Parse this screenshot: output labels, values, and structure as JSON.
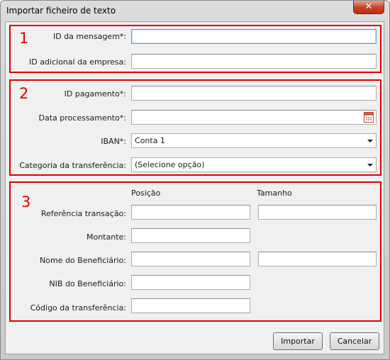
{
  "window": {
    "title": "Importar ficheiro de texto",
    "close_glyph": "✕"
  },
  "groups": [
    {
      "number": "1",
      "fields": [
        {
          "label": "ID da mensagem*:",
          "value": ""
        },
        {
          "label": "ID adicional da empresa:",
          "value": ""
        }
      ]
    },
    {
      "number": "2",
      "fields": [
        {
          "label": "ID pagamento*:",
          "value": ""
        },
        {
          "label": "Data processamento*:",
          "value": ""
        },
        {
          "label": "IBAN*:",
          "value": "Conta 1"
        },
        {
          "label": "Categoria da transferência:",
          "value": "(Selecione opção)"
        }
      ]
    },
    {
      "number": "3",
      "headers": {
        "position": "Posição",
        "size": "Tamanho"
      },
      "fields": [
        {
          "label": "Referência transação:",
          "position": "",
          "size": ""
        },
        {
          "label": "Montante:",
          "position": ""
        },
        {
          "label": "Nome do Beneficiário:",
          "position": "",
          "size": ""
        },
        {
          "label": "NIB do Beneficiário:",
          "position": ""
        },
        {
          "label": "Código da transferência:",
          "position": ""
        }
      ]
    }
  ],
  "buttons": {
    "import": "Importar",
    "cancel": "Cancelar"
  },
  "icons": {
    "calendar": "calendar-icon",
    "dropdown": "chevron-down-icon",
    "close": "close-icon"
  },
  "colors": {
    "group_border": "#e00000",
    "close_button": "#c8452a",
    "focus_border": "#6d9ad8"
  }
}
